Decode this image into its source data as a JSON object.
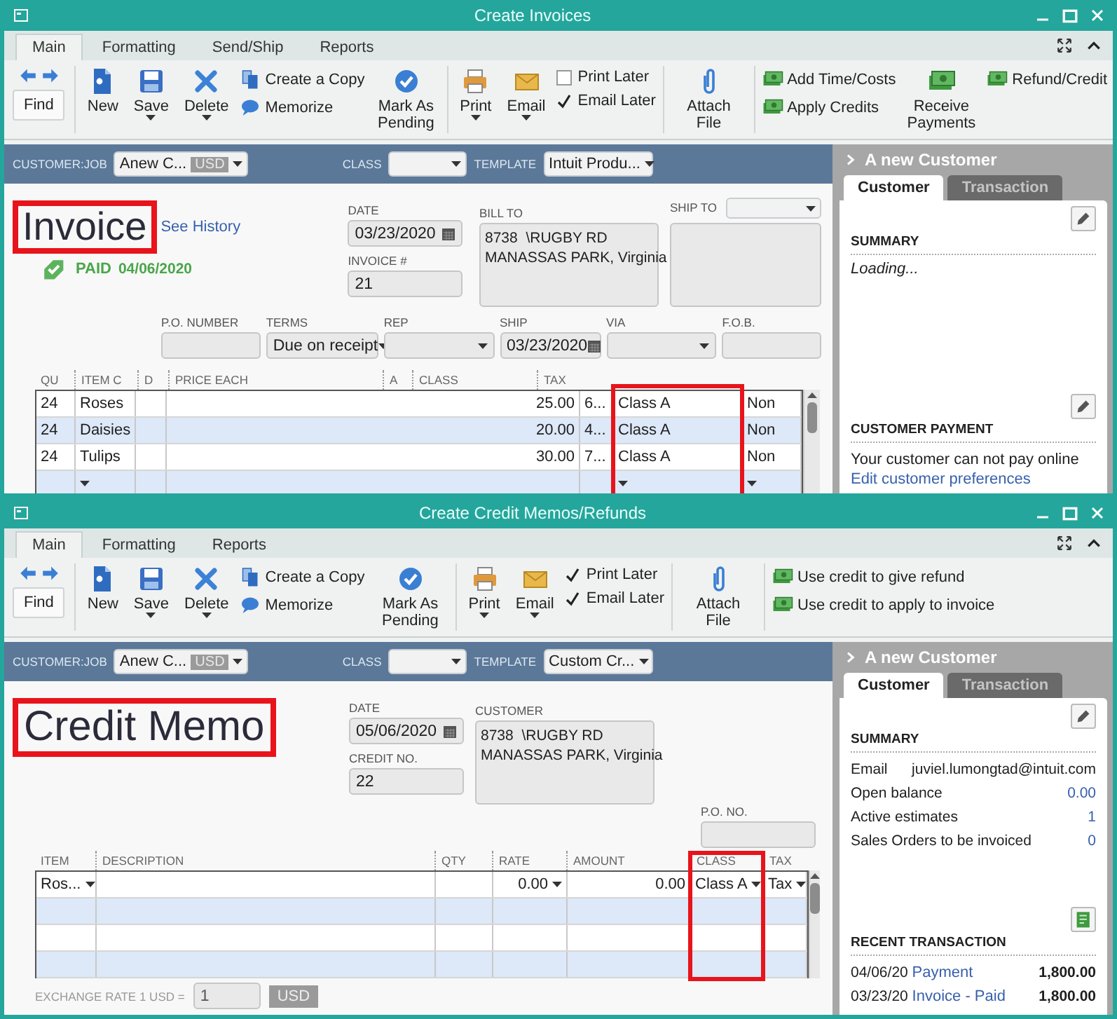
{
  "windows": [
    {
      "title": "Create Invoices",
      "ribbon_tabs": [
        {
          "label": "Main",
          "selected": true
        },
        {
          "label": "Formatting",
          "selected": false
        },
        {
          "label": "Send/Ship",
          "selected": false
        },
        {
          "label": "Reports",
          "selected": false
        }
      ],
      "toolbar": [
        [
          {
            "kind": "find",
            "label": "Find"
          }
        ],
        [
          {
            "kind": "new",
            "label": "New",
            "menu": false
          },
          {
            "kind": "save",
            "label": "Save",
            "menu": true
          },
          {
            "kind": "delete",
            "label": "Delete",
            "menu": true
          },
          {
            "stack": [
              {
                "kind": "copy",
                "label": "Create a Copy"
              },
              {
                "kind": "memorize",
                "label": "Memorize"
              }
            ]
          },
          {
            "kind": "mark",
            "label": "Mark As Pending",
            "menu": false
          }
        ],
        [
          {
            "kind": "print",
            "label": "Print",
            "menu": true
          },
          {
            "kind": "email",
            "label": "Email",
            "menu": true
          },
          {
            "stack": [
              {
                "kind": "check",
                "label": "Print Later",
                "checked": false
              },
              {
                "kind": "check",
                "label": "Email Later",
                "checked": true
              }
            ]
          }
        ],
        [
          {
            "kind": "attach",
            "label": "Attach File",
            "menu": false
          }
        ],
        [
          {
            "stack": [
              {
                "kind": "money",
                "label": "Add Time/Costs"
              },
              {
                "kind": "money",
                "label": "Apply Credits"
              }
            ]
          },
          {
            "kind": "money",
            "label": "Receive Payments",
            "menu": false
          },
          {
            "stack": [
              {
                "kind": "money",
                "label": "Refund/Credit"
              }
            ]
          }
        ]
      ],
      "header": {
        "customer_job": {
          "label": "CUSTOMER:JOB",
          "value": "Anew C...",
          "currency": "USD"
        },
        "class": {
          "label": "CLASS"
        },
        "template": {
          "label": "TEMPLATE",
          "value": "Intuit Produ..."
        }
      },
      "document": {
        "kind": "invoice",
        "title": "Invoice",
        "title_highlighted": true,
        "history_link": "See History",
        "status": {
          "label": "PAID",
          "date": "04/06/2020"
        },
        "date": {
          "label": "DATE",
          "value": "03/23/2020"
        },
        "number": {
          "label": "INVOICE #",
          "value": "21"
        },
        "address": {
          "label": "BILL TO",
          "lines": [
            "8738  \\RUGBY RD",
            "MANASSAS PARK, Virginia"
          ]
        },
        "ship_to": {
          "label": "SHIP TO"
        },
        "details": [
          {
            "label": "P.O. NUMBER",
            "kind": "text"
          },
          {
            "label": "TERMS",
            "kind": "select",
            "value": "Due on receipt"
          },
          {
            "label": "REP",
            "kind": "select"
          },
          {
            "label": "SHIP",
            "kind": "date",
            "value": "03/23/2020"
          },
          {
            "label": "VIA",
            "kind": "select"
          },
          {
            "label": "F.O.B.",
            "kind": "text"
          }
        ],
        "table": {
          "class_highlighted": true,
          "columns": [
            {
              "label": "QU"
            },
            {
              "label": "ITEM C"
            },
            {
              "label": "D"
            },
            {
              "label": "PRICE EACH"
            },
            {
              "label": "A"
            },
            {
              "label": "CLASS"
            },
            {
              "label": "TAX"
            }
          ],
          "rows": [
            {
              "qty": "24",
              "item": "Roses",
              "price": "25.00",
              "amount": "6...",
              "class": "Class A",
              "tax": "Non"
            },
            {
              "qty": "24",
              "item": "Daisies",
              "price": "20.00",
              "amount": "4...",
              "class": "Class A",
              "tax": "Non"
            },
            {
              "qty": "24",
              "item": "Tulips",
              "price": "30.00",
              "amount": "7...",
              "class": "Class A",
              "tax": "Non"
            }
          ]
        }
      },
      "side_panel": {
        "title": "A new Customer",
        "tabs": [
          {
            "label": "Customer",
            "selected": true
          },
          {
            "label": "Transaction",
            "selected": false
          }
        ],
        "sections": [
          {
            "heading": "SUMMARY",
            "kind": "edit",
            "status": "Loading..."
          },
          {
            "heading": "CUSTOMER PAYMENT",
            "kind": "edit",
            "note": "Your customer can not pay online",
            "link": "Edit customer preferences"
          }
        ]
      }
    },
    {
      "title": "Create Credit Memos/Refunds",
      "ribbon_tabs": [
        {
          "label": "Main",
          "selected": true
        },
        {
          "label": "Formatting",
          "selected": false
        },
        {
          "label": "Reports",
          "selected": false
        }
      ],
      "toolbar": [
        [
          {
            "kind": "find",
            "label": "Find"
          }
        ],
        [
          {
            "kind": "new",
            "label": "New",
            "menu": false
          },
          {
            "kind": "save",
            "label": "Save",
            "menu": true
          },
          {
            "kind": "delete",
            "label": "Delete",
            "menu": true
          },
          {
            "stack": [
              {
                "kind": "copy",
                "label": "Create a Copy"
              },
              {
                "kind": "memorize",
                "label": "Memorize"
              }
            ]
          },
          {
            "kind": "mark",
            "label": "Mark As Pending",
            "menu": false
          }
        ],
        [
          {
            "kind": "print",
            "label": "Print",
            "menu": true
          },
          {
            "kind": "email",
            "label": "Email",
            "menu": true
          },
          {
            "stack": [
              {
                "kind": "check",
                "label": "Print Later",
                "checked": true
              },
              {
                "kind": "check",
                "label": "Email Later",
                "checked": true
              }
            ]
          }
        ],
        [
          {
            "kind": "attach",
            "label": "Attach File",
            "menu": false
          }
        ],
        [
          {
            "stack": [
              {
                "kind": "money",
                "label": "Use credit to give refund"
              },
              {
                "kind": "money",
                "label": "Use credit to apply to invoice"
              }
            ]
          }
        ]
      ],
      "header": {
        "customer_job": {
          "label": "CUSTOMER:JOB",
          "value": "Anew C...",
          "currency": "USD"
        },
        "class": {
          "label": "CLASS"
        },
        "template": {
          "label": "TEMPLATE",
          "value": "Custom Cr..."
        }
      },
      "document": {
        "kind": "credit_memo",
        "title": "Credit Memo",
        "title_highlighted": true,
        "date": {
          "label": "DATE",
          "value": "05/06/2020"
        },
        "number": {
          "label": "CREDIT NO.",
          "value": "22"
        },
        "address": {
          "label": "CUSTOMER",
          "lines": [
            "8738  \\RUGBY RD",
            "MANASSAS PARK, Virginia"
          ]
        },
        "po": {
          "label": "P.O. NO."
        },
        "table": {
          "class_highlighted": true,
          "columns": [
            {
              "label": "ITEM"
            },
            {
              "label": "DESCRIPTION"
            },
            {
              "label": "QTY"
            },
            {
              "label": "RATE"
            },
            {
              "label": "AMOUNT"
            },
            {
              "label": "CLASS"
            },
            {
              "label": "TAX"
            }
          ],
          "rows": [
            {
              "item": "Ros...",
              "rate": "0.00",
              "amount": "0.00",
              "class": "Class A",
              "tax": "Tax"
            }
          ]
        },
        "exchange": {
          "label": "EXCHANGE RATE 1 USD =",
          "value": "1",
          "currency": "USD"
        }
      },
      "side_panel": {
        "title": "A new Customer",
        "tabs": [
          {
            "label": "Customer",
            "selected": true
          },
          {
            "label": "Transaction",
            "selected": false
          }
        ],
        "sections": [
          {
            "heading": "SUMMARY",
            "kind": "edit",
            "rows": [
              {
                "label": "Email",
                "value": "juviel.lumongtad@intuit.com",
                "kind": "text"
              },
              {
                "label": "Open balance",
                "value": "0.00",
                "kind": "link"
              },
              {
                "label": "Active estimates",
                "value": "1",
                "kind": "link"
              },
              {
                "label": "Sales Orders to be invoiced",
                "value": "0",
                "kind": "link"
              }
            ]
          },
          {
            "heading": "RECENT TRANSACTION",
            "kind": "report",
            "transactions": [
              {
                "date": "04/06/20",
                "label": "Payment",
                "amount": "1,800.00"
              },
              {
                "date": "03/23/20",
                "label": "Invoice - Paid",
                "amount": "1,800.00"
              }
            ]
          }
        ]
      }
    }
  ]
}
